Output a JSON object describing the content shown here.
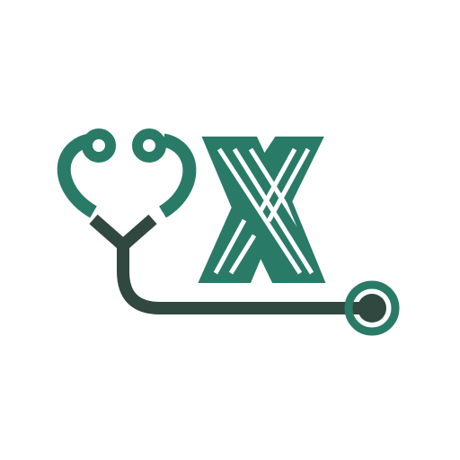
{
  "logo": {
    "icon_name": "stethoscope-x-logo",
    "letter": "X",
    "colors": {
      "background": "#ffffff",
      "primary_teal": "#2a7a68",
      "dark_tube": "#30483f"
    }
  }
}
